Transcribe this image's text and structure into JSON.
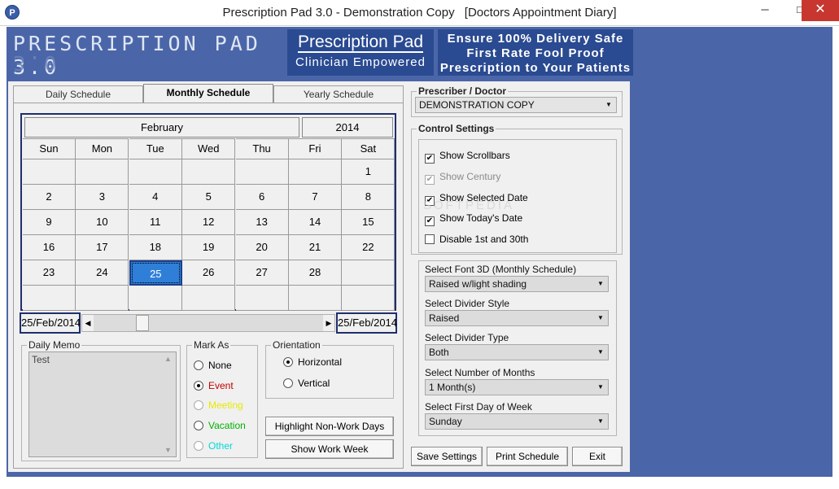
{
  "window": {
    "title_app": "Prescription Pad 3.0 - Demonstration Copy",
    "title_module": "[Doctors Appointment Diary]",
    "minimize": "─",
    "maximize": "□",
    "close": "✕",
    "icon_letter": "P"
  },
  "banner": {
    "brand": "PRESCRIPTION PAD 3.0",
    "pp_title": "Prescription Pad",
    "pp_sub": "Clinician Empowered",
    "tag1": "Ensure 100% Delivery Safe",
    "tag2": "First Rate Fool Proof",
    "tag3": "Prescription to Your Patients",
    "colors": {
      "banner": "#4b66a8",
      "panel": "#2a4a91"
    }
  },
  "tabs": [
    "Daily Schedule",
    "Monthly Schedule",
    "Yearly Schedule"
  ],
  "calendar": {
    "month": "February",
    "year": "2014",
    "weekdays": [
      "Sun",
      "Mon",
      "Tue",
      "Wed",
      "Thu",
      "Fri",
      "Sat"
    ],
    "rows": [
      [
        "",
        "",
        "",
        "",
        "",
        "",
        "1"
      ],
      [
        "2",
        "3",
        "4",
        "5",
        "6",
        "7",
        "8"
      ],
      [
        "9",
        "10",
        "11",
        "12",
        "13",
        "14",
        "15"
      ],
      [
        "16",
        "17",
        "18",
        "19",
        "20",
        "21",
        "22"
      ],
      [
        "23",
        "24",
        "25",
        "26",
        "27",
        "28",
        ""
      ],
      [
        "",
        "",
        "",
        "",
        "",
        "",
        ""
      ]
    ],
    "selected_day": "25",
    "date_left": "25/Feb/2014",
    "date_right": "25/Feb/2014",
    "selected_color": "#2f7fd8"
  },
  "memo": {
    "label": "Daily Memo",
    "text": "Test",
    "scroll_up": "▲",
    "scroll_down": "▼"
  },
  "mark_as": {
    "label": "Mark As",
    "options": [
      {
        "label": "None",
        "color": "#000000",
        "checked": false,
        "disabled": false
      },
      {
        "label": "Event",
        "color": "#c00000",
        "checked": true,
        "disabled": false
      },
      {
        "label": "Meeting",
        "color": "#e8e800",
        "checked": false,
        "disabled": true
      },
      {
        "label": "Vacation",
        "color": "#00b000",
        "checked": false,
        "disabled": false
      },
      {
        "label": "Other",
        "color": "#00d8d8",
        "checked": false,
        "disabled": true
      }
    ]
  },
  "orientation": {
    "label": "Orientation",
    "options": [
      {
        "label": "Horizontal",
        "checked": true
      },
      {
        "label": "Vertical",
        "checked": false
      }
    ]
  },
  "buttons": {
    "highlight": "Highlight Non-Work Days",
    "work_week": "Show Work Week",
    "save": "Save Settings",
    "print": "Print Schedule",
    "exit": "Exit"
  },
  "prescriber": {
    "label": "Prescriber / Doctor",
    "value": "DEMONSTRATION COPY"
  },
  "control_settings": {
    "label": "Control Settings",
    "checks": [
      {
        "label": "Show Scrollbars",
        "checked": true,
        "disabled": false
      },
      {
        "label": "Show Century",
        "checked": true,
        "disabled": true
      },
      {
        "label": "Show Selected Date",
        "checked": true,
        "disabled": false
      },
      {
        "label": "Show Today's Date",
        "checked": true,
        "disabled": false
      },
      {
        "label": "Disable 1st and 30th",
        "checked": false,
        "disabled": false
      }
    ],
    "selects": [
      {
        "label": "Select Font 3D (Monthly Schedule)",
        "value": "Raised w/light shading"
      },
      {
        "label": "Select Divider Style",
        "value": "Raised"
      },
      {
        "label": "Select Divider Type",
        "value": "Both"
      },
      {
        "label": "Select Number of Months",
        "value": "1 Month(s)"
      },
      {
        "label": "Select First Day of Week",
        "value": "Sunday"
      }
    ]
  },
  "icons": {
    "dropdown": "▼",
    "scroll_left": "◀",
    "scroll_right": "▶",
    "checkmark": "✔"
  }
}
